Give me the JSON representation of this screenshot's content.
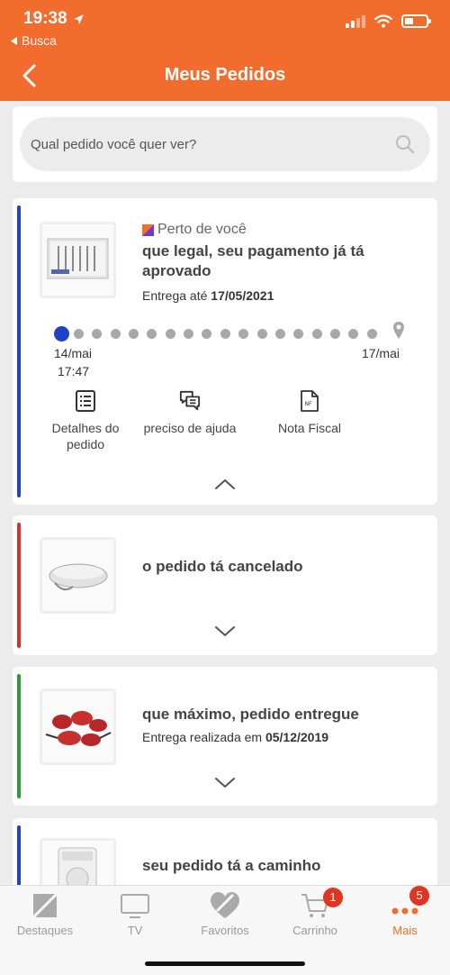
{
  "status_bar": {
    "time": "19:38",
    "back_label": "Busca"
  },
  "header": {
    "title": "Meus Pedidos"
  },
  "search": {
    "placeholder": "Qual pedido você quer ver?"
  },
  "orders": [
    {
      "tag": "Perto de você",
      "status": "que legal, seu pagamento já tá aprovado",
      "delivery_prefix": "Entrega até",
      "delivery_date": "17/05/2021",
      "bar_color": "#2043c6",
      "timeline": {
        "start_date": "14/mai",
        "start_time": "17:47",
        "end_date": "17/mai",
        "dots": 18
      },
      "actions": [
        {
          "label": "Detalhes do pedido",
          "icon": "list-icon"
        },
        {
          "label": "preciso de ajuda",
          "icon": "chat-icon"
        },
        {
          "label": "Nota Fiscal",
          "icon": "invoice-icon"
        }
      ]
    },
    {
      "status": "o pedido tá cancelado",
      "bar_color": "#d0342c"
    },
    {
      "status": "que máximo, pedido entregue",
      "delivery_prefix": "Entrega realizada em",
      "delivery_date": "05/12/2019",
      "bar_color": "#2f9a3a"
    },
    {
      "status": "seu pedido tá a caminho",
      "bar_color": "#2043c6"
    }
  ],
  "nav": [
    {
      "label": "Destaques",
      "icon": "highlights-icon"
    },
    {
      "label": "TV",
      "icon": "tv-icon"
    },
    {
      "label": "Favoritos",
      "icon": "heart-icon"
    },
    {
      "label": "Carrinho",
      "icon": "cart-icon",
      "badge": "1"
    },
    {
      "label": "Mais",
      "icon": "more-icon",
      "badge": "5",
      "active": true
    }
  ],
  "colors": {
    "brand": "#f26d2d",
    "badge": "#e0351e"
  }
}
